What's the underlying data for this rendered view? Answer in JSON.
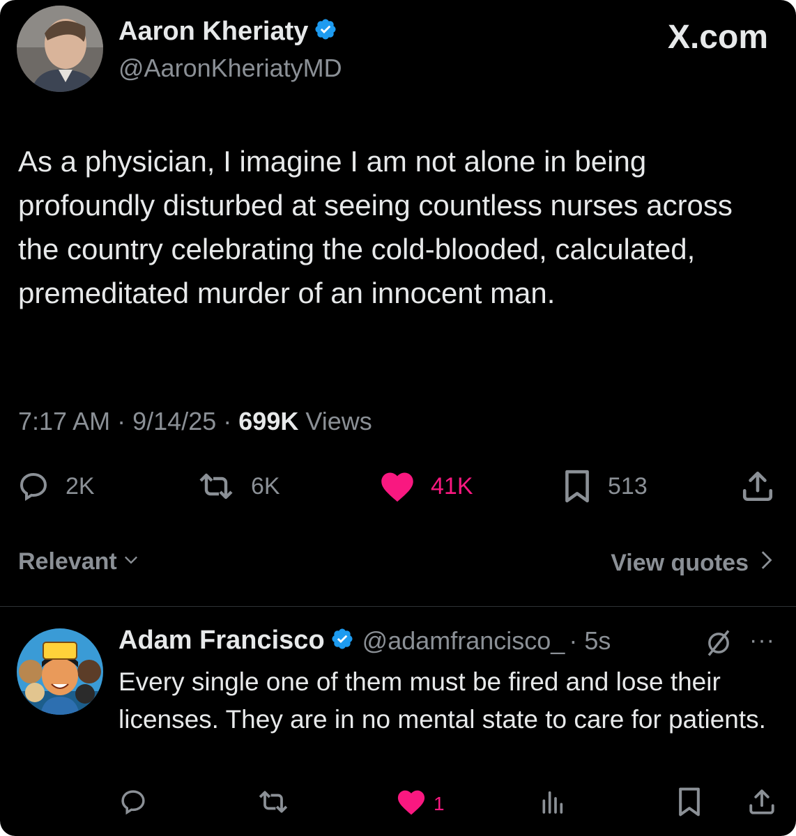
{
  "brand": {
    "label": "X.com"
  },
  "post": {
    "author": {
      "name": "Aaron Kheriaty",
      "handle": "@AaronKheriatyMD",
      "verified": true
    },
    "text": "As a physician, I imagine I am not alone in being profoundly disturbed at seeing countless nurses across the country celebrating the cold-blooded, calculated, premeditated murder of an innocent man.",
    "time": "7:17 AM",
    "date": "9/14/25",
    "separator": "·",
    "views_count": "699K",
    "views_label": "Views",
    "actions": {
      "reply_count": "2K",
      "repost_count": "6K",
      "like_count": "41K",
      "bookmark_count": "513"
    }
  },
  "replies_bar": {
    "sort_label": "Relevant",
    "quotes_label": "View quotes"
  },
  "reply": {
    "author": {
      "name": "Adam Francisco",
      "handle": "@adamfrancisco_",
      "verified": true
    },
    "age": "· 5s",
    "text": "Every single one of them must be fired and lose their licenses. They are in no mental state to care for patients.",
    "like_count": "1",
    "more_label": "···"
  },
  "icons": {
    "reply": "speech-bubble-icon",
    "repost": "repost-arrows-icon",
    "like": "heart-icon",
    "bookmark": "bookmark-icon",
    "share": "share-upload-icon",
    "views": "bar-chart-icon",
    "grok": "slashed-circle-icon",
    "verified": "verified-badge-icon"
  },
  "colors": {
    "background": "#000000",
    "text": "#e7e9ea",
    "muted": "#8b9096",
    "like": "#f91880",
    "verified": "#1d9bf0"
  }
}
